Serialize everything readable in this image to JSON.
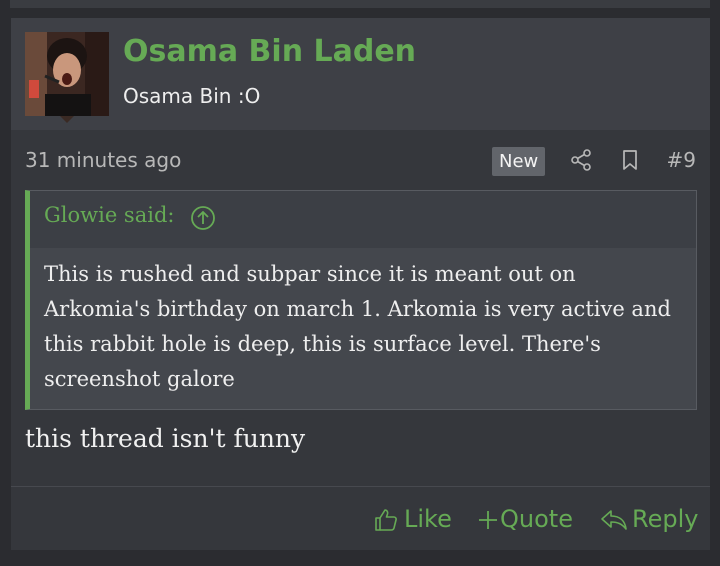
{
  "user": {
    "name": "Osama Bin Laden",
    "title": "Osama Bin :O"
  },
  "meta": {
    "time": "31 minutes ago",
    "badge": "New",
    "post_number": "#9"
  },
  "quote": {
    "author": "Glowie said:",
    "text": "This is rushed and subpar since it is meant out on Arkomia's birthday on march 1. Arkomia is very active and this rabbit hole is deep, this is surface level. There's screenshot galore"
  },
  "body": "this thread isn't funny",
  "actions": {
    "like": "Like",
    "quote": "Quote",
    "reply": "Reply"
  },
  "colors": {
    "accent": "#66aa55",
    "background": "#35373c",
    "header": "#3e4046"
  }
}
